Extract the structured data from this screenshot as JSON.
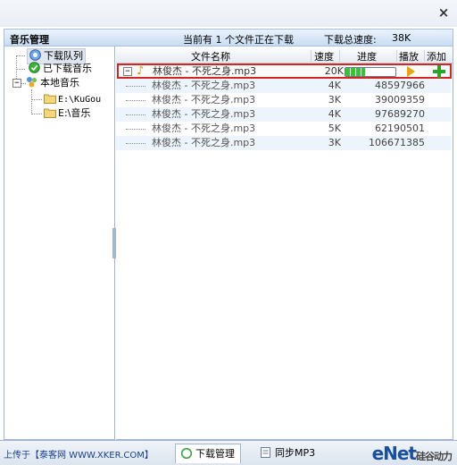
{
  "window": {
    "close_glyph": "×"
  },
  "header": {
    "title": "音乐管理",
    "status": "当前有 1 个文件正在下载",
    "speed_label": "下载总速度:",
    "speed_value": "38K"
  },
  "sidebar": {
    "items": [
      {
        "label": "下载队列",
        "icon": "download-queue-icon"
      },
      {
        "label": "已下载音乐",
        "icon": "checkmark-icon"
      },
      {
        "label": "本地音乐",
        "icon": "local-music-icon"
      },
      {
        "label": "E:\\KuGou",
        "icon": "folder-icon"
      },
      {
        "label": "E:\\音乐",
        "icon": "folder-icon"
      }
    ]
  },
  "columns": [
    "文件名称",
    "速度",
    "进度",
    "播放",
    "添加"
  ],
  "main_task": {
    "name": "林俊杰 - 不死之身.mp3",
    "speed": "20K",
    "progress": 0.4
  },
  "sources": [
    {
      "name": "林俊杰 - 不死之身.mp3",
      "speed": "4K",
      "progress": "48597966"
    },
    {
      "name": "林俊杰 - 不死之身.mp3",
      "speed": "3K",
      "progress": "39009359"
    },
    {
      "name": "林俊杰 - 不死之身.mp3",
      "speed": "4K",
      "progress": "97689270"
    },
    {
      "name": "林俊杰 - 不死之身.mp3",
      "speed": "5K",
      "progress": "62190501"
    },
    {
      "name": "林俊杰 - 不死之身.mp3",
      "speed": "3K",
      "progress": "106671385"
    }
  ],
  "bottom": {
    "upload_text": "上传于【泰客网 WWW.XKER.COM】",
    "tabs": [
      "下载管理",
      "同步MP3"
    ],
    "brand": "eNet",
    "brand_sub": "硅谷动力"
  },
  "colors": {
    "accent": "#1a4fa0",
    "highlight_border": "#d42424",
    "progress_fill": "#38c238"
  }
}
